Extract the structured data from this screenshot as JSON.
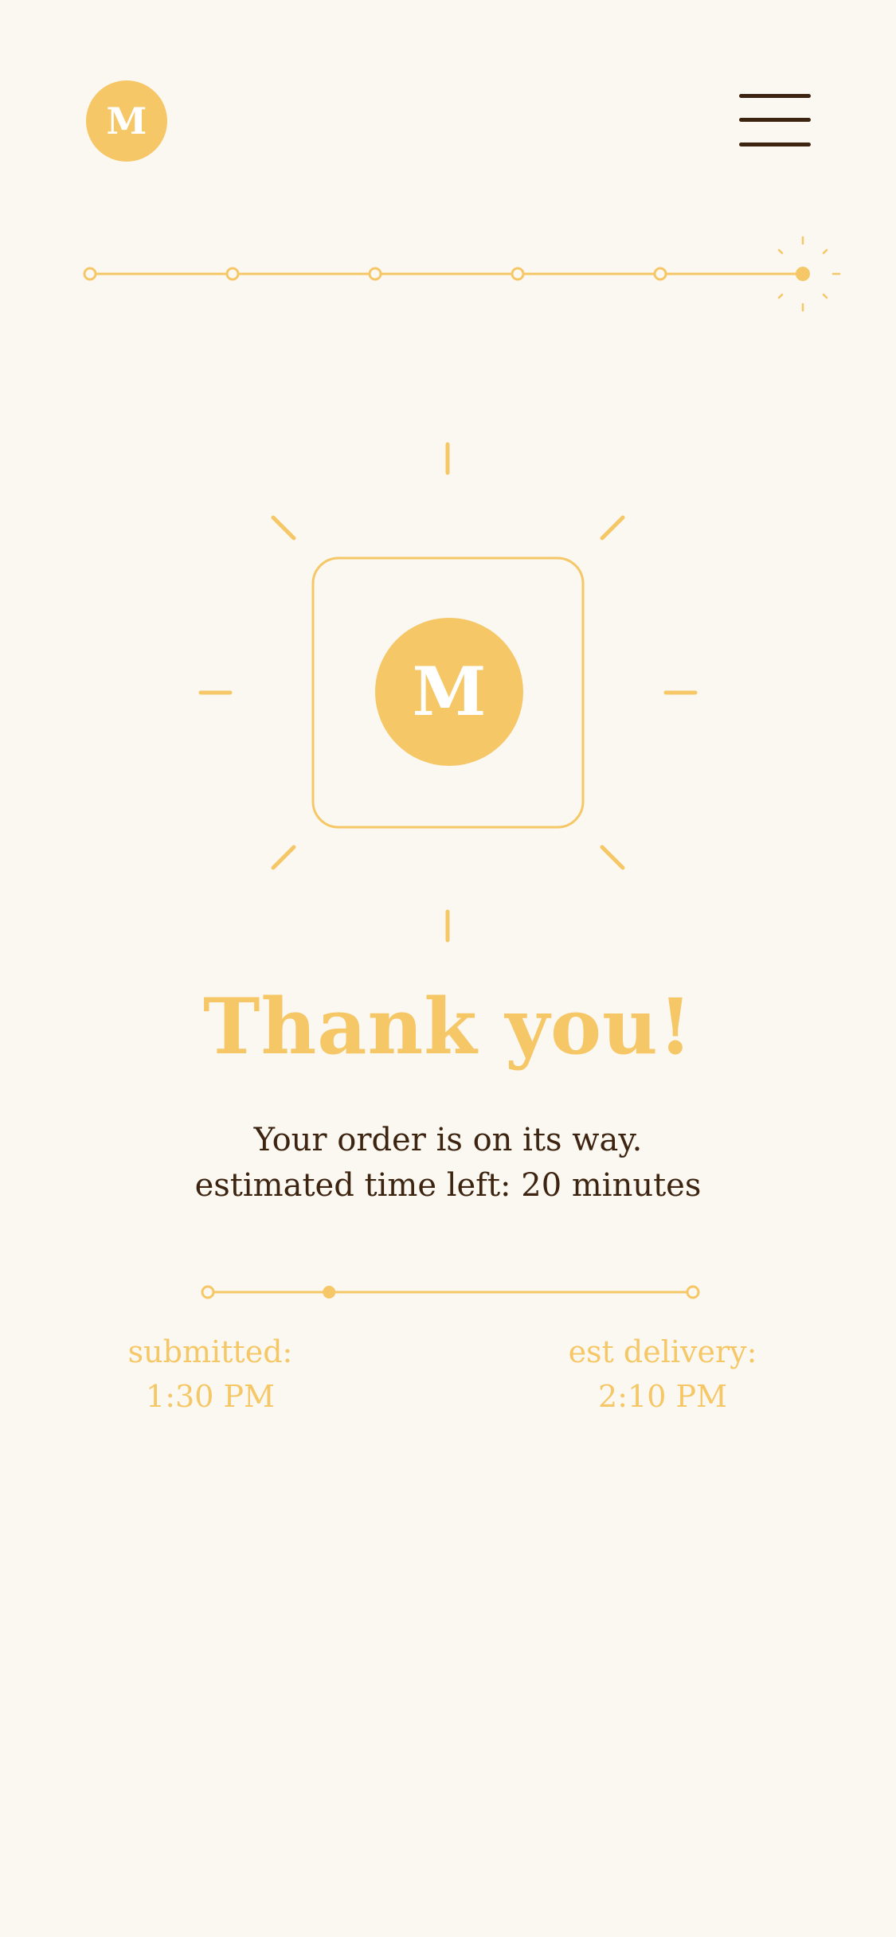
{
  "brand": {
    "logo_letter": "M",
    "color_primary": "#F6C766",
    "color_text": "#3D2410",
    "color_background": "#FBF8F1"
  },
  "header": {
    "menu_icon": "hamburger-menu-icon"
  },
  "steps_progress": {
    "total_steps": 6,
    "current_step": 6
  },
  "hero": {
    "logo_letter": "M"
  },
  "message": {
    "title": "Thank you!",
    "line1": "Your order is on its way.",
    "line2": "estimated time left: 20 minutes"
  },
  "delivery_timeline": {
    "progress": 0.25,
    "submitted_label": "submitted:",
    "submitted_time": "1:30 PM",
    "delivery_label": "est delivery:",
    "delivery_time": "2:10 PM"
  }
}
